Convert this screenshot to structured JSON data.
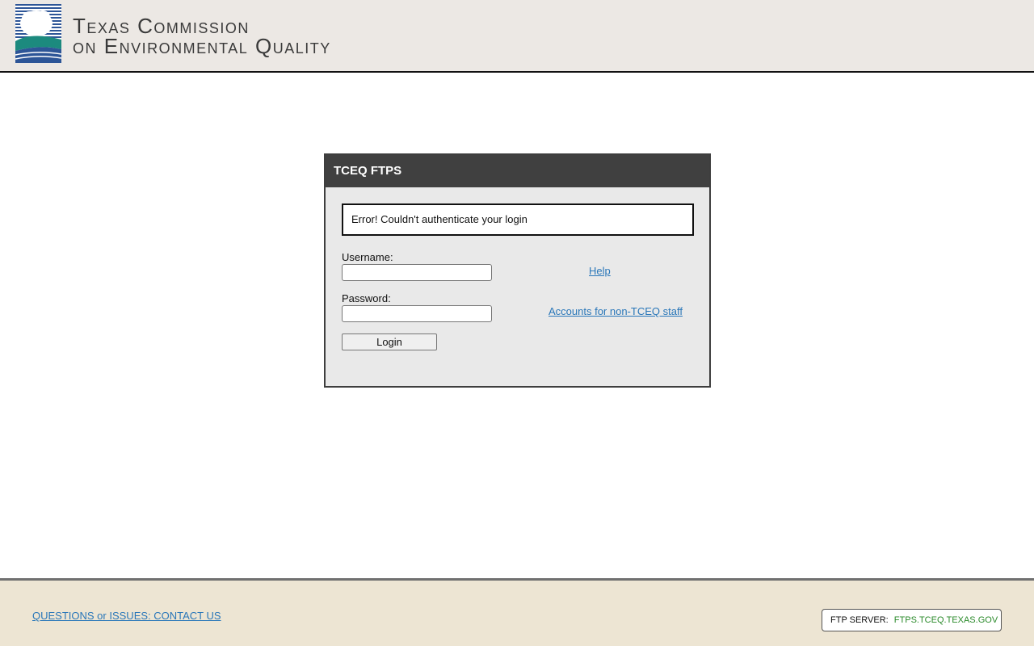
{
  "header": {
    "logo_line1": "Texas Commission",
    "logo_line2": "on Environmental Quality"
  },
  "panel": {
    "title": "TCEQ FTPS",
    "error_message": "Error! Couldn't authenticate your login",
    "username_label": "Username:",
    "username_value": "",
    "password_label": "Password:",
    "password_value": "",
    "help_link": "Help",
    "accounts_link": "Accounts for non-TCEQ staff",
    "login_button": "Login"
  },
  "footer": {
    "contact_link": "QUESTIONS or ISSUES: CONTACT US",
    "server_label": "FTP SERVER:",
    "server_value": "FTPS.TCEQ.TEXAS.GOV"
  },
  "colors": {
    "header_bg": "#ece8e4",
    "panel_title_bg": "#404040",
    "link": "#2a77b9",
    "footer_bg": "#ede5d3",
    "server_value": "#2a8a2a",
    "logo_blue": "#2d5597",
    "logo_teal": "#1c8a7e"
  },
  "icons": {
    "logo": "tceq-logo-icon"
  }
}
